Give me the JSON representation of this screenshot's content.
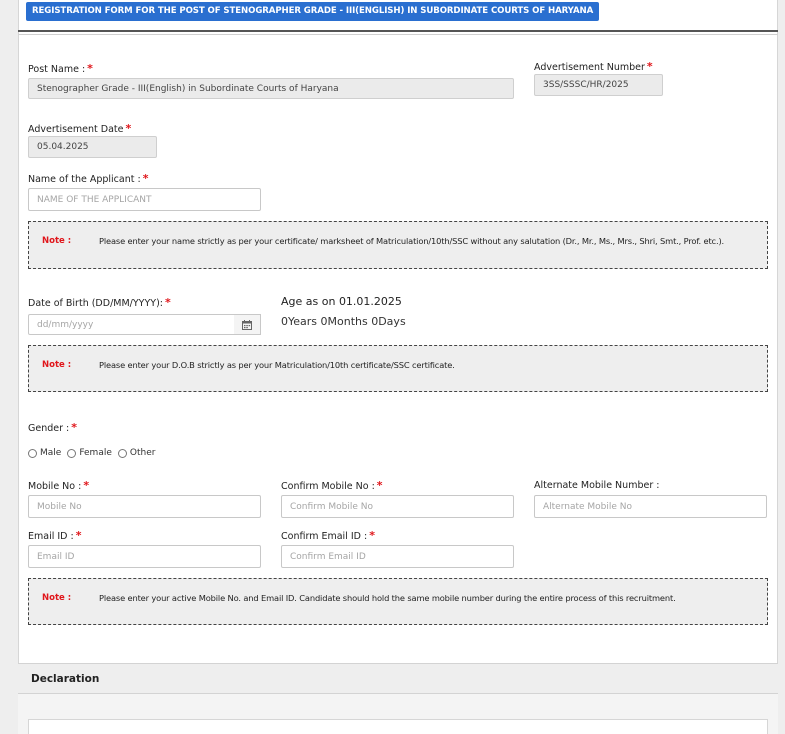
{
  "header": {
    "title": "REGISTRATION FORM FOR THE POST OF STENOGRAPHER GRADE - III(ENGLISH) IN SUBORDINATE COURTS OF HARYANA"
  },
  "form": {
    "post_name": {
      "label": "Post Name :",
      "required": "*",
      "value": "Stenographer Grade - III(English) in Subordinate Courts of Haryana"
    },
    "advertisement_number": {
      "label": "Advertisement Number",
      "required": "*",
      "value": "3SS/SSSC/HR/2025"
    },
    "advertisement_date": {
      "label": "Advertisement Date",
      "required": "*",
      "value": "05.04.2025"
    },
    "applicant_name": {
      "label": "Name of the Applicant :",
      "required": "*",
      "placeholder": "NAME OF THE APPLICANT"
    },
    "name_note": {
      "label": "Note :",
      "text": "Please enter your name strictly as per your certificate/ marksheet of Matriculation/10th/SSC without any salutation (Dr., Mr., Ms., Mrs., Shri, Smt., Prof. etc.)."
    },
    "dob": {
      "label": "Date of Birth (DD/MM/YYYY):",
      "required": "*",
      "placeholder": "dd/mm/yyyy",
      "icon": "calendar-icon"
    },
    "age": {
      "title": "Age as on 01.01.2025",
      "value": "0Years 0Months 0Days"
    },
    "dob_note": {
      "label": "Note :",
      "text": "Please enter your D.O.B strictly as per your Matriculation/10th certificate/SSC certificate."
    },
    "gender": {
      "label": "Gender :",
      "required": "*",
      "options": [
        "Male",
        "Female",
        "Other"
      ]
    },
    "mobile": {
      "label": "Mobile No :",
      "required": "*",
      "placeholder": "Mobile No"
    },
    "confirm_mobile": {
      "label": "Confirm Mobile No :",
      "required": "*",
      "placeholder": "Confirm Mobile No"
    },
    "alt_mobile": {
      "label": "Alternate Mobile Number :",
      "placeholder": "Alternate Mobile No"
    },
    "email": {
      "label": "Email ID :",
      "required": "*",
      "placeholder": "Email ID"
    },
    "confirm_email": {
      "label": "Confirm Email ID :",
      "required": "*",
      "placeholder": "Confirm Email ID"
    },
    "contact_note": {
      "label": "Note :",
      "text": "Please enter your active Mobile No. and Email ID. Candidate should hold the same mobile number during the entire process of this recruitment."
    }
  },
  "declaration": {
    "title": "Declaration"
  },
  "colors": {
    "accent": "#2a6fd0",
    "required": "#e0161b",
    "note_bg": "#eeeeee"
  }
}
